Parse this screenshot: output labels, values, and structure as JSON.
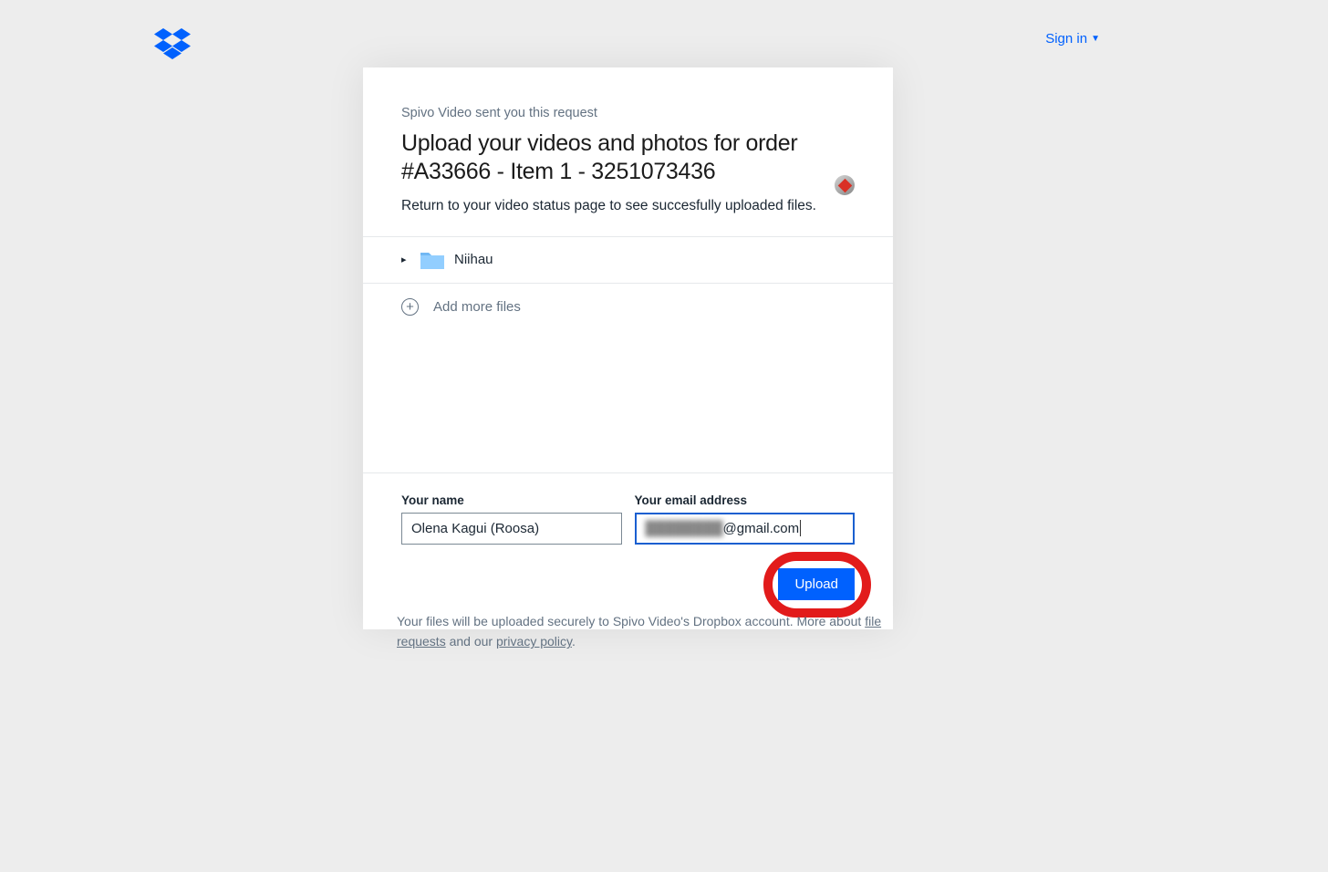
{
  "header": {
    "sign_in_label": "Sign in"
  },
  "card": {
    "request_from": "Spivo Video sent you this request",
    "title": "Upload your videos and photos for order #A33666 - Item 1 - 3251073436",
    "subtitle": "Return to your video status page to see succesfully uploaded files."
  },
  "folder": {
    "name": "Niihau"
  },
  "add_more": {
    "label": "Add more files"
  },
  "form": {
    "name_label": "Your name",
    "name_value": "Olena Kagui (Roosa)",
    "email_label": "Your email address",
    "email_value_suffix": "@gmail.com",
    "email_value_prefix_blurred": "████████"
  },
  "upload": {
    "label": "Upload"
  },
  "footer": {
    "text_1": "Your files will be uploaded securely to Spivo Video's Dropbox account. More about ",
    "link_1": "file requests",
    "text_2": " and our ",
    "link_2": "privacy policy",
    "text_3": "."
  }
}
